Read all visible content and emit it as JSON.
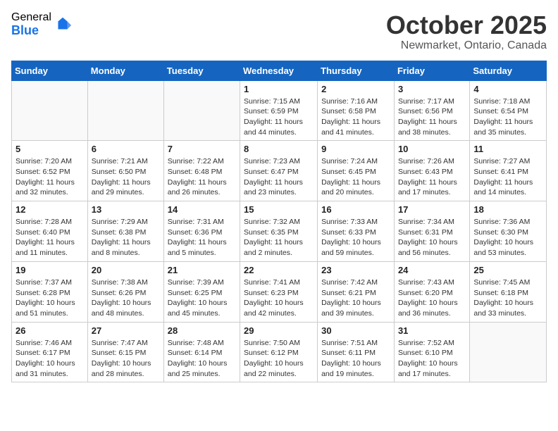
{
  "header": {
    "logo_general": "General",
    "logo_blue": "Blue",
    "month": "October 2025",
    "location": "Newmarket, Ontario, Canada"
  },
  "weekdays": [
    "Sunday",
    "Monday",
    "Tuesday",
    "Wednesday",
    "Thursday",
    "Friday",
    "Saturday"
  ],
  "weeks": [
    [
      {
        "day": "",
        "info": ""
      },
      {
        "day": "",
        "info": ""
      },
      {
        "day": "",
        "info": ""
      },
      {
        "day": "1",
        "info": "Sunrise: 7:15 AM\nSunset: 6:59 PM\nDaylight: 11 hours and 44 minutes."
      },
      {
        "day": "2",
        "info": "Sunrise: 7:16 AM\nSunset: 6:58 PM\nDaylight: 11 hours and 41 minutes."
      },
      {
        "day": "3",
        "info": "Sunrise: 7:17 AM\nSunset: 6:56 PM\nDaylight: 11 hours and 38 minutes."
      },
      {
        "day": "4",
        "info": "Sunrise: 7:18 AM\nSunset: 6:54 PM\nDaylight: 11 hours and 35 minutes."
      }
    ],
    [
      {
        "day": "5",
        "info": "Sunrise: 7:20 AM\nSunset: 6:52 PM\nDaylight: 11 hours and 32 minutes."
      },
      {
        "day": "6",
        "info": "Sunrise: 7:21 AM\nSunset: 6:50 PM\nDaylight: 11 hours and 29 minutes."
      },
      {
        "day": "7",
        "info": "Sunrise: 7:22 AM\nSunset: 6:48 PM\nDaylight: 11 hours and 26 minutes."
      },
      {
        "day": "8",
        "info": "Sunrise: 7:23 AM\nSunset: 6:47 PM\nDaylight: 11 hours and 23 minutes."
      },
      {
        "day": "9",
        "info": "Sunrise: 7:24 AM\nSunset: 6:45 PM\nDaylight: 11 hours and 20 minutes."
      },
      {
        "day": "10",
        "info": "Sunrise: 7:26 AM\nSunset: 6:43 PM\nDaylight: 11 hours and 17 minutes."
      },
      {
        "day": "11",
        "info": "Sunrise: 7:27 AM\nSunset: 6:41 PM\nDaylight: 11 hours and 14 minutes."
      }
    ],
    [
      {
        "day": "12",
        "info": "Sunrise: 7:28 AM\nSunset: 6:40 PM\nDaylight: 11 hours and 11 minutes."
      },
      {
        "day": "13",
        "info": "Sunrise: 7:29 AM\nSunset: 6:38 PM\nDaylight: 11 hours and 8 minutes."
      },
      {
        "day": "14",
        "info": "Sunrise: 7:31 AM\nSunset: 6:36 PM\nDaylight: 11 hours and 5 minutes."
      },
      {
        "day": "15",
        "info": "Sunrise: 7:32 AM\nSunset: 6:35 PM\nDaylight: 11 hours and 2 minutes."
      },
      {
        "day": "16",
        "info": "Sunrise: 7:33 AM\nSunset: 6:33 PM\nDaylight: 10 hours and 59 minutes."
      },
      {
        "day": "17",
        "info": "Sunrise: 7:34 AM\nSunset: 6:31 PM\nDaylight: 10 hours and 56 minutes."
      },
      {
        "day": "18",
        "info": "Sunrise: 7:36 AM\nSunset: 6:30 PM\nDaylight: 10 hours and 53 minutes."
      }
    ],
    [
      {
        "day": "19",
        "info": "Sunrise: 7:37 AM\nSunset: 6:28 PM\nDaylight: 10 hours and 51 minutes."
      },
      {
        "day": "20",
        "info": "Sunrise: 7:38 AM\nSunset: 6:26 PM\nDaylight: 10 hours and 48 minutes."
      },
      {
        "day": "21",
        "info": "Sunrise: 7:39 AM\nSunset: 6:25 PM\nDaylight: 10 hours and 45 minutes."
      },
      {
        "day": "22",
        "info": "Sunrise: 7:41 AM\nSunset: 6:23 PM\nDaylight: 10 hours and 42 minutes."
      },
      {
        "day": "23",
        "info": "Sunrise: 7:42 AM\nSunset: 6:21 PM\nDaylight: 10 hours and 39 minutes."
      },
      {
        "day": "24",
        "info": "Sunrise: 7:43 AM\nSunset: 6:20 PM\nDaylight: 10 hours and 36 minutes."
      },
      {
        "day": "25",
        "info": "Sunrise: 7:45 AM\nSunset: 6:18 PM\nDaylight: 10 hours and 33 minutes."
      }
    ],
    [
      {
        "day": "26",
        "info": "Sunrise: 7:46 AM\nSunset: 6:17 PM\nDaylight: 10 hours and 31 minutes."
      },
      {
        "day": "27",
        "info": "Sunrise: 7:47 AM\nSunset: 6:15 PM\nDaylight: 10 hours and 28 minutes."
      },
      {
        "day": "28",
        "info": "Sunrise: 7:48 AM\nSunset: 6:14 PM\nDaylight: 10 hours and 25 minutes."
      },
      {
        "day": "29",
        "info": "Sunrise: 7:50 AM\nSunset: 6:12 PM\nDaylight: 10 hours and 22 minutes."
      },
      {
        "day": "30",
        "info": "Sunrise: 7:51 AM\nSunset: 6:11 PM\nDaylight: 10 hours and 19 minutes."
      },
      {
        "day": "31",
        "info": "Sunrise: 7:52 AM\nSunset: 6:10 PM\nDaylight: 10 hours and 17 minutes."
      },
      {
        "day": "",
        "info": ""
      }
    ]
  ]
}
